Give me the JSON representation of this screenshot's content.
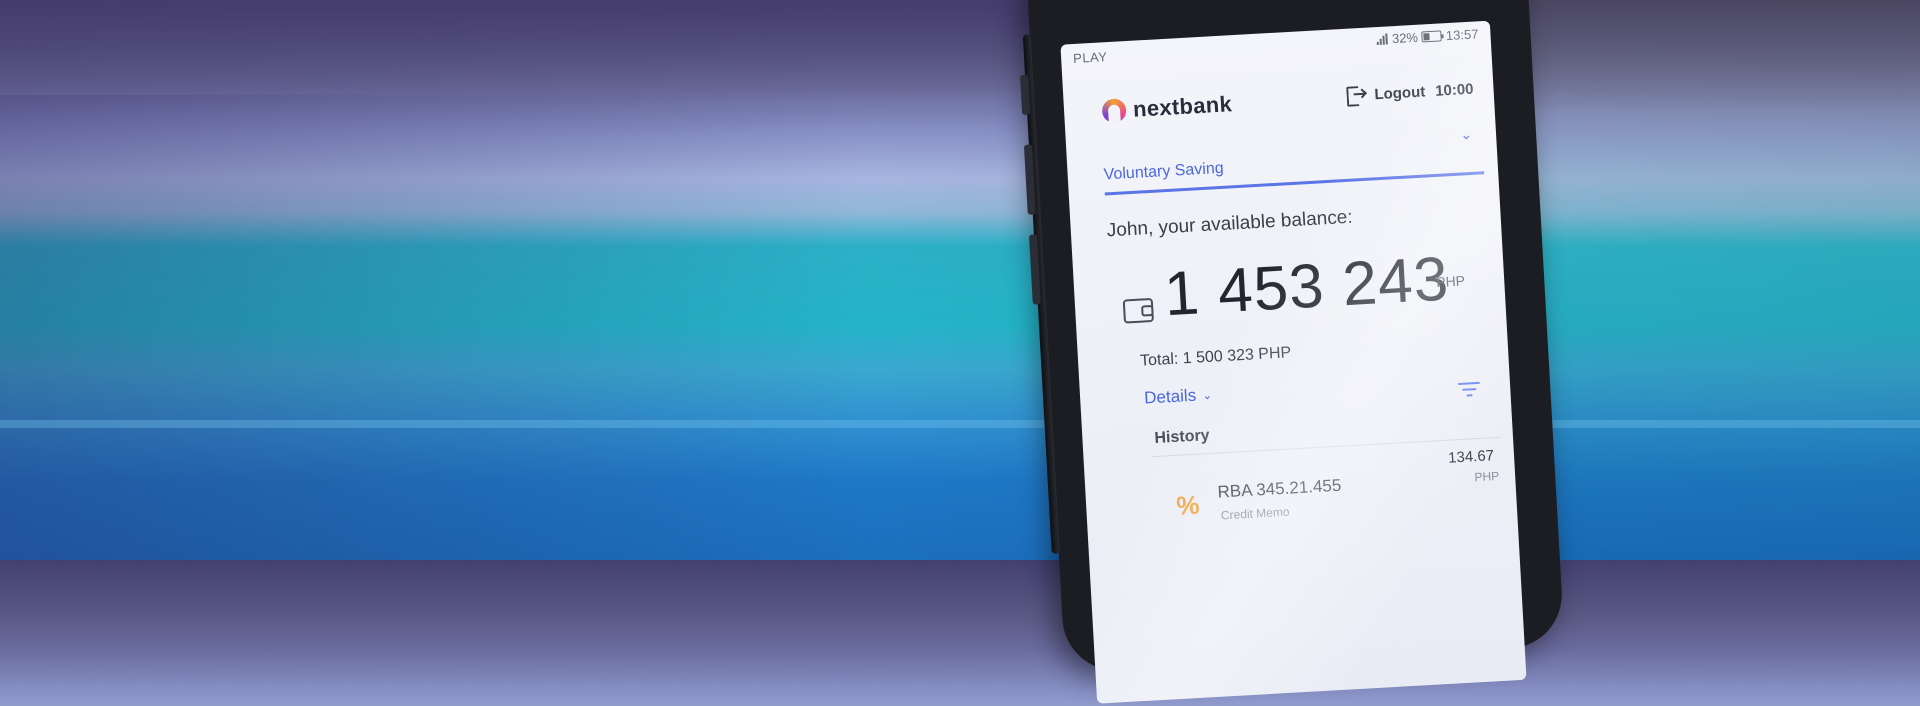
{
  "statusbar": {
    "carrier": "PLAY",
    "battery": "32%",
    "time": "13:57"
  },
  "header": {
    "brand": "nextbank",
    "logout_label": "Logout",
    "session_timer": "10:00"
  },
  "account": {
    "selected": "Voluntary Saving"
  },
  "balance": {
    "caption": "John, your available balance:",
    "amount": "1 453 243",
    "currency": "PHP",
    "total": "Total: 1 500 323 PHP",
    "details_label": "Details"
  },
  "history": {
    "title": "History",
    "transactions": [
      {
        "name": "RBA 345.21.455",
        "type": "Credit Memo",
        "amount": "134.67",
        "currency": "PHP",
        "icon": "percent-icon"
      }
    ]
  },
  "colors": {
    "accent": "#4a66e0",
    "tx_icon": "#f0a341"
  }
}
